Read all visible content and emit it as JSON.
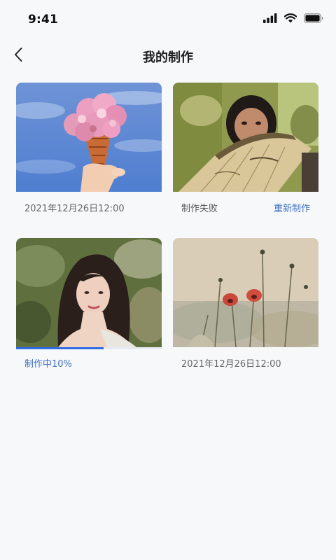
{
  "status_bar": {
    "time": "9:41",
    "icons": [
      "signal-icon",
      "wifi-icon",
      "battery-icon"
    ]
  },
  "nav": {
    "back_icon": "chevron-left-icon",
    "title": "我的制作"
  },
  "works": [
    {
      "image": "flowers-ice-cream-cone-photo",
      "status": "done",
      "date": "2021年12月26日12:00"
    },
    {
      "image": "woman-with-fan-photo",
      "status": "failed",
      "status_text": "制作失败",
      "retry_label": "重新制作"
    },
    {
      "image": "girl-portrait-photo",
      "status": "processing",
      "progress_text": "制作中10%",
      "progress": 0.6
    },
    {
      "image": "poppies-field-photo",
      "status": "done",
      "date": "2021年12月26日12:00"
    }
  ],
  "colors": {
    "accent": "#2e6be6",
    "link": "#3d6fc0",
    "background": "#f7f8fa"
  }
}
